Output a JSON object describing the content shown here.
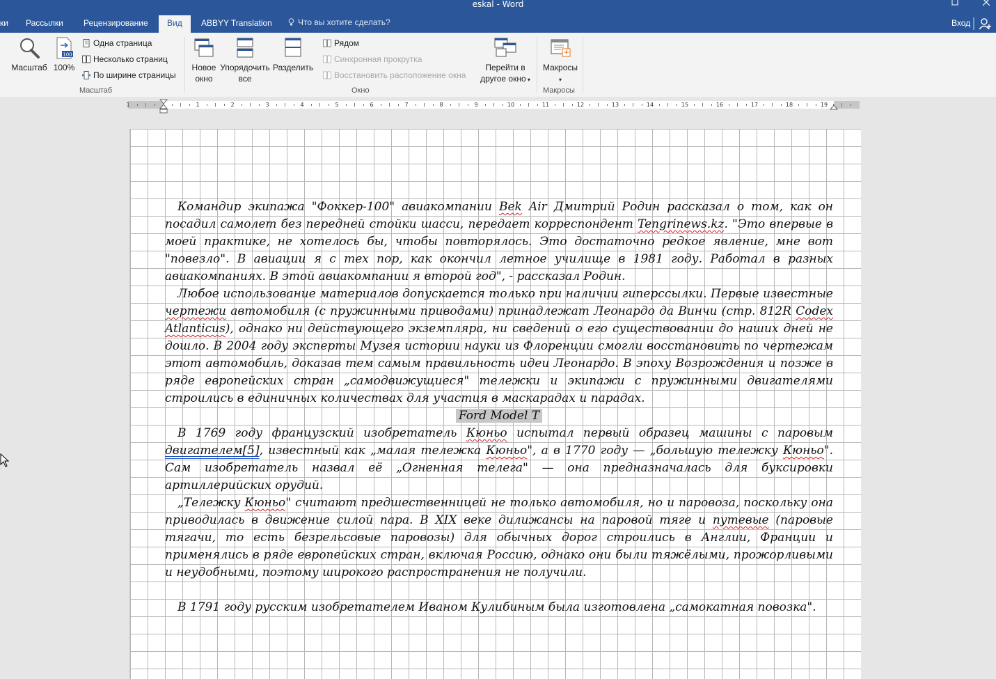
{
  "window": {
    "title": "eskal - Word"
  },
  "tabs": [
    {
      "label": "ки",
      "active": false
    },
    {
      "label": "Рассылки",
      "active": false
    },
    {
      "label": "Рецензирование",
      "active": false
    },
    {
      "label": "Вид",
      "active": true
    },
    {
      "label": "ABBYY Translation",
      "active": false
    }
  ],
  "tellme": {
    "label": "Что вы хотите сделать?"
  },
  "signin": {
    "label": "Вход"
  },
  "ribbon": {
    "zoom_group": {
      "label": "Масштаб",
      "zoom_button": "Масштаб",
      "zoom100_button": "100%",
      "one_page": "Одна страница",
      "multiple_pages": "Несколько страниц",
      "page_width": "По ширине страницы"
    },
    "window_group": {
      "label": "Окно",
      "new_window_1": "Новое",
      "new_window_2": "окно",
      "arrange_all_1": "Упорядочить",
      "arrange_all_2": "все",
      "split": "Разделить",
      "side_by_side": "Рядом",
      "sync_scroll": "Синхронная прокрутка",
      "reset_position": "Восстановить расположение окна",
      "switch_window_1": "Перейти в",
      "switch_window_2": "другое окно"
    },
    "macros_group": {
      "label": "Макросы",
      "macros_button": "Макросы"
    }
  },
  "ruler": {
    "numbers": [
      "1",
      "1",
      "2",
      "3",
      "4",
      "5",
      "6",
      "7",
      "8",
      "9",
      "10",
      "11",
      "12",
      "13",
      "14",
      "15",
      "16",
      "17",
      "18",
      "19"
    ]
  },
  "document": {
    "p1": {
      "a": "Командир экипажа \"Фоккер-100\" авиакомпании ",
      "b": "Bek",
      "c": " ",
      "d": "Air",
      "e": " Дмитрий Родин рассказал о том, как он посадил самолет без передней стойки шасси, передает корреспондент ",
      "f": "Tengrinews.kz",
      "g": ". \"Это впервые в моей практике, не хотелось бы, чтобы повторялось. Это достаточно редкое явление, мне вот \"повезло\". В авиации я с тех пор, как окончил летное училище в 1981 году. Работал в разных авиакомпаниях. В этой авиакомпании я второй год\", - рассказал Родин."
    },
    "p2": {
      "a": "Любое использование материалов допускается только при наличии гиперссылки. Первые известные ",
      "b": "чертежи",
      "c": " автомобиля (с пружинными приводами) принадлежат Леонардо да Винчи (стр. 812R ",
      "d": "Codex",
      "e": " ",
      "f": "Atlanticus",
      "g": "), однако ни действующего экземпляра, ни сведений о его существовании до наших дней не дошло. В 2004 году эксперты Музея истории науки из Флоренции смогли восстановить по чертежам этот автомобиль, доказав тем самым правильность идеи Леонардо. В эпоху Возрождения и позже в ряде европейских стран „самодвижущиеся\" тележки и экипажи с пружинными двигателями строились в единичных количествах для участия в маскарадах и парадах."
    },
    "heading": "Ford Model T",
    "p3": {
      "a": "В 1769 году французский изобретатель ",
      "b": "Кюньо",
      "c": " испытал первый образец машины с паровым ",
      "d": "двигателем[5]",
      "e": ", известный как „малая тележка ",
      "f": "Кюньо",
      "g": "\", а в 1770 году — „большую тележку ",
      "h": "Кюньо",
      "i": "\". Сам изобретатель назвал её „Огненная телега\" — она предназначалась для буксировки артиллерийских орудий."
    },
    "p4": {
      "a": "„Тележку ",
      "b": "Кюньо",
      "c": "\" считают предшественницей не только автомобиля, но и паровоза, поскольку она приводилась в движение силой пара. В XIX веке дилижансы на паровой тяге и ",
      "d": "путевые",
      "e": " (паровые тягачи, то есть безрельсовые паровозы) для обычных дорог строились в Англии, Франции и применялись в ряде европейских стран, включая Россию, однако они были тяжёлыми, прожорливыми и неудобными, поэтому широкого распространения не получили."
    },
    "p5": "В 1791 году русским изобретателем Иваном Кулибиным была изготовлена „самокатная повозка\"."
  }
}
